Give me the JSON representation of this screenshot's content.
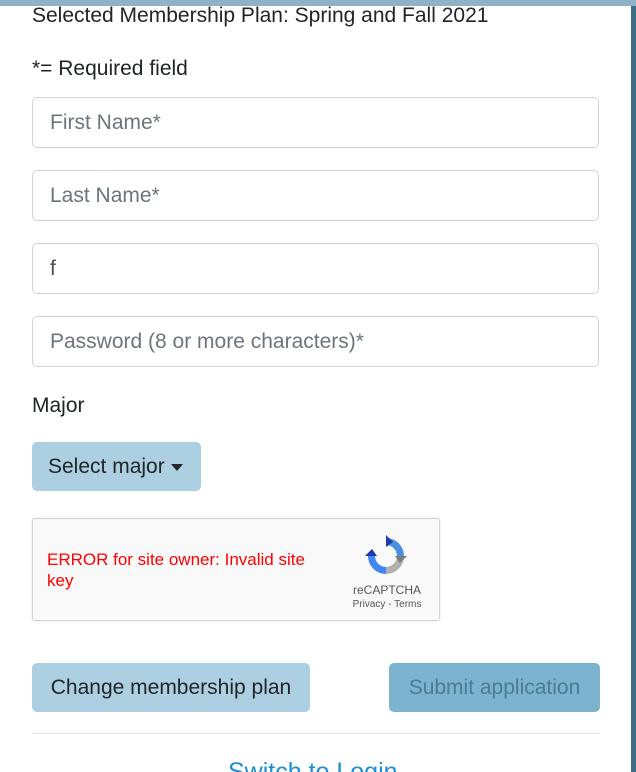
{
  "header": {
    "plan_title": "Selected Membership Plan: Spring and Fall 2021",
    "required_note": "*= Required field"
  },
  "form": {
    "first_name": {
      "value": "",
      "placeholder": "First Name*"
    },
    "last_name": {
      "value": "",
      "placeholder": "Last Name*"
    },
    "email": {
      "value": "f",
      "placeholder": ""
    },
    "password": {
      "value": "",
      "placeholder": "Password (8 or more characters)*"
    },
    "major_label": "Major",
    "major_button_label": "Select major"
  },
  "captcha": {
    "error_text": "ERROR for site owner: Invalid site key",
    "brand": "reCAPTCHA",
    "links": "Privacy - Terms",
    "icon": "recaptcha-icon"
  },
  "actions": {
    "change_plan_label": "Change membership plan",
    "submit_label": "Submit application",
    "switch_login_label": "Switch to Login"
  },
  "colors": {
    "button_light": "#acd0e2",
    "button_disabled": "#7cb4cf",
    "error": "#ff0000",
    "link": "#1a8fd4"
  }
}
